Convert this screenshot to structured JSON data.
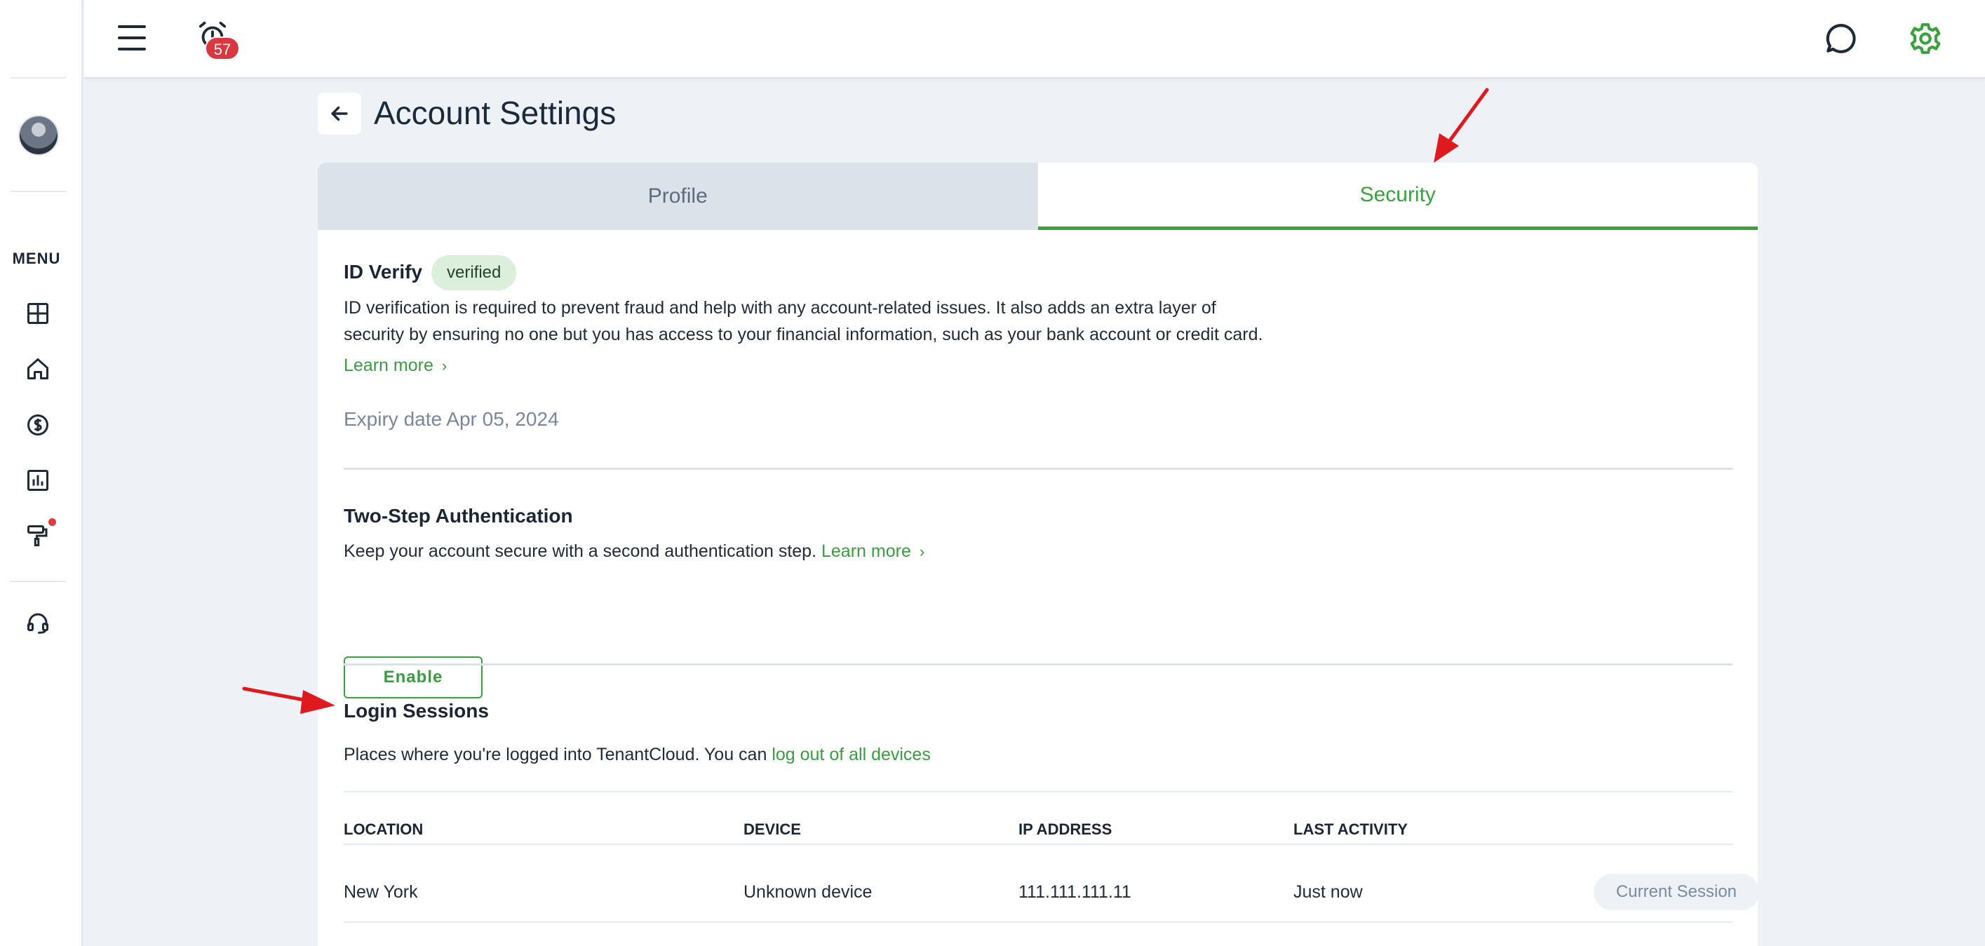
{
  "topbar": {
    "notification_count": "57"
  },
  "sidebar": {
    "menu_label": "MENU"
  },
  "header": {
    "title": "Account Settings"
  },
  "tabs": [
    {
      "label": "Profile",
      "active": false
    },
    {
      "label": "Security",
      "active": true
    }
  ],
  "id_verify": {
    "title": "ID Verify",
    "status_badge": "verified",
    "description_line1": "ID verification is required to prevent fraud and help with any account-related issues. It also adds an extra layer of",
    "description_line2": "security by ensuring no one but you has access to your financial information, such as your bank account or credit card.",
    "learn_more": "Learn more",
    "expiry": "Expiry date Apr 05, 2024"
  },
  "two_step": {
    "title": "Two-Step Authentication",
    "description": "Keep your account secure with a second authentication step.",
    "learn_more": "Learn more",
    "enable_label": "Enable"
  },
  "login_sessions": {
    "title": "Login Sessions",
    "description": "Places where you're logged into TenantCloud. You can",
    "logout_link": "log out of all devices",
    "columns": [
      "LOCATION",
      "DEVICE",
      "IP ADDRESS",
      "LAST ACTIVITY"
    ],
    "rows": [
      {
        "location": "New York",
        "device": "Unknown device",
        "ip": "111.111.111.11",
        "last_activity": "Just now",
        "badge": "Current Session"
      }
    ]
  },
  "colors": {
    "accent_green": "#3aa040",
    "badge_red": "#d9393e",
    "annotation_red": "#e0191f"
  }
}
